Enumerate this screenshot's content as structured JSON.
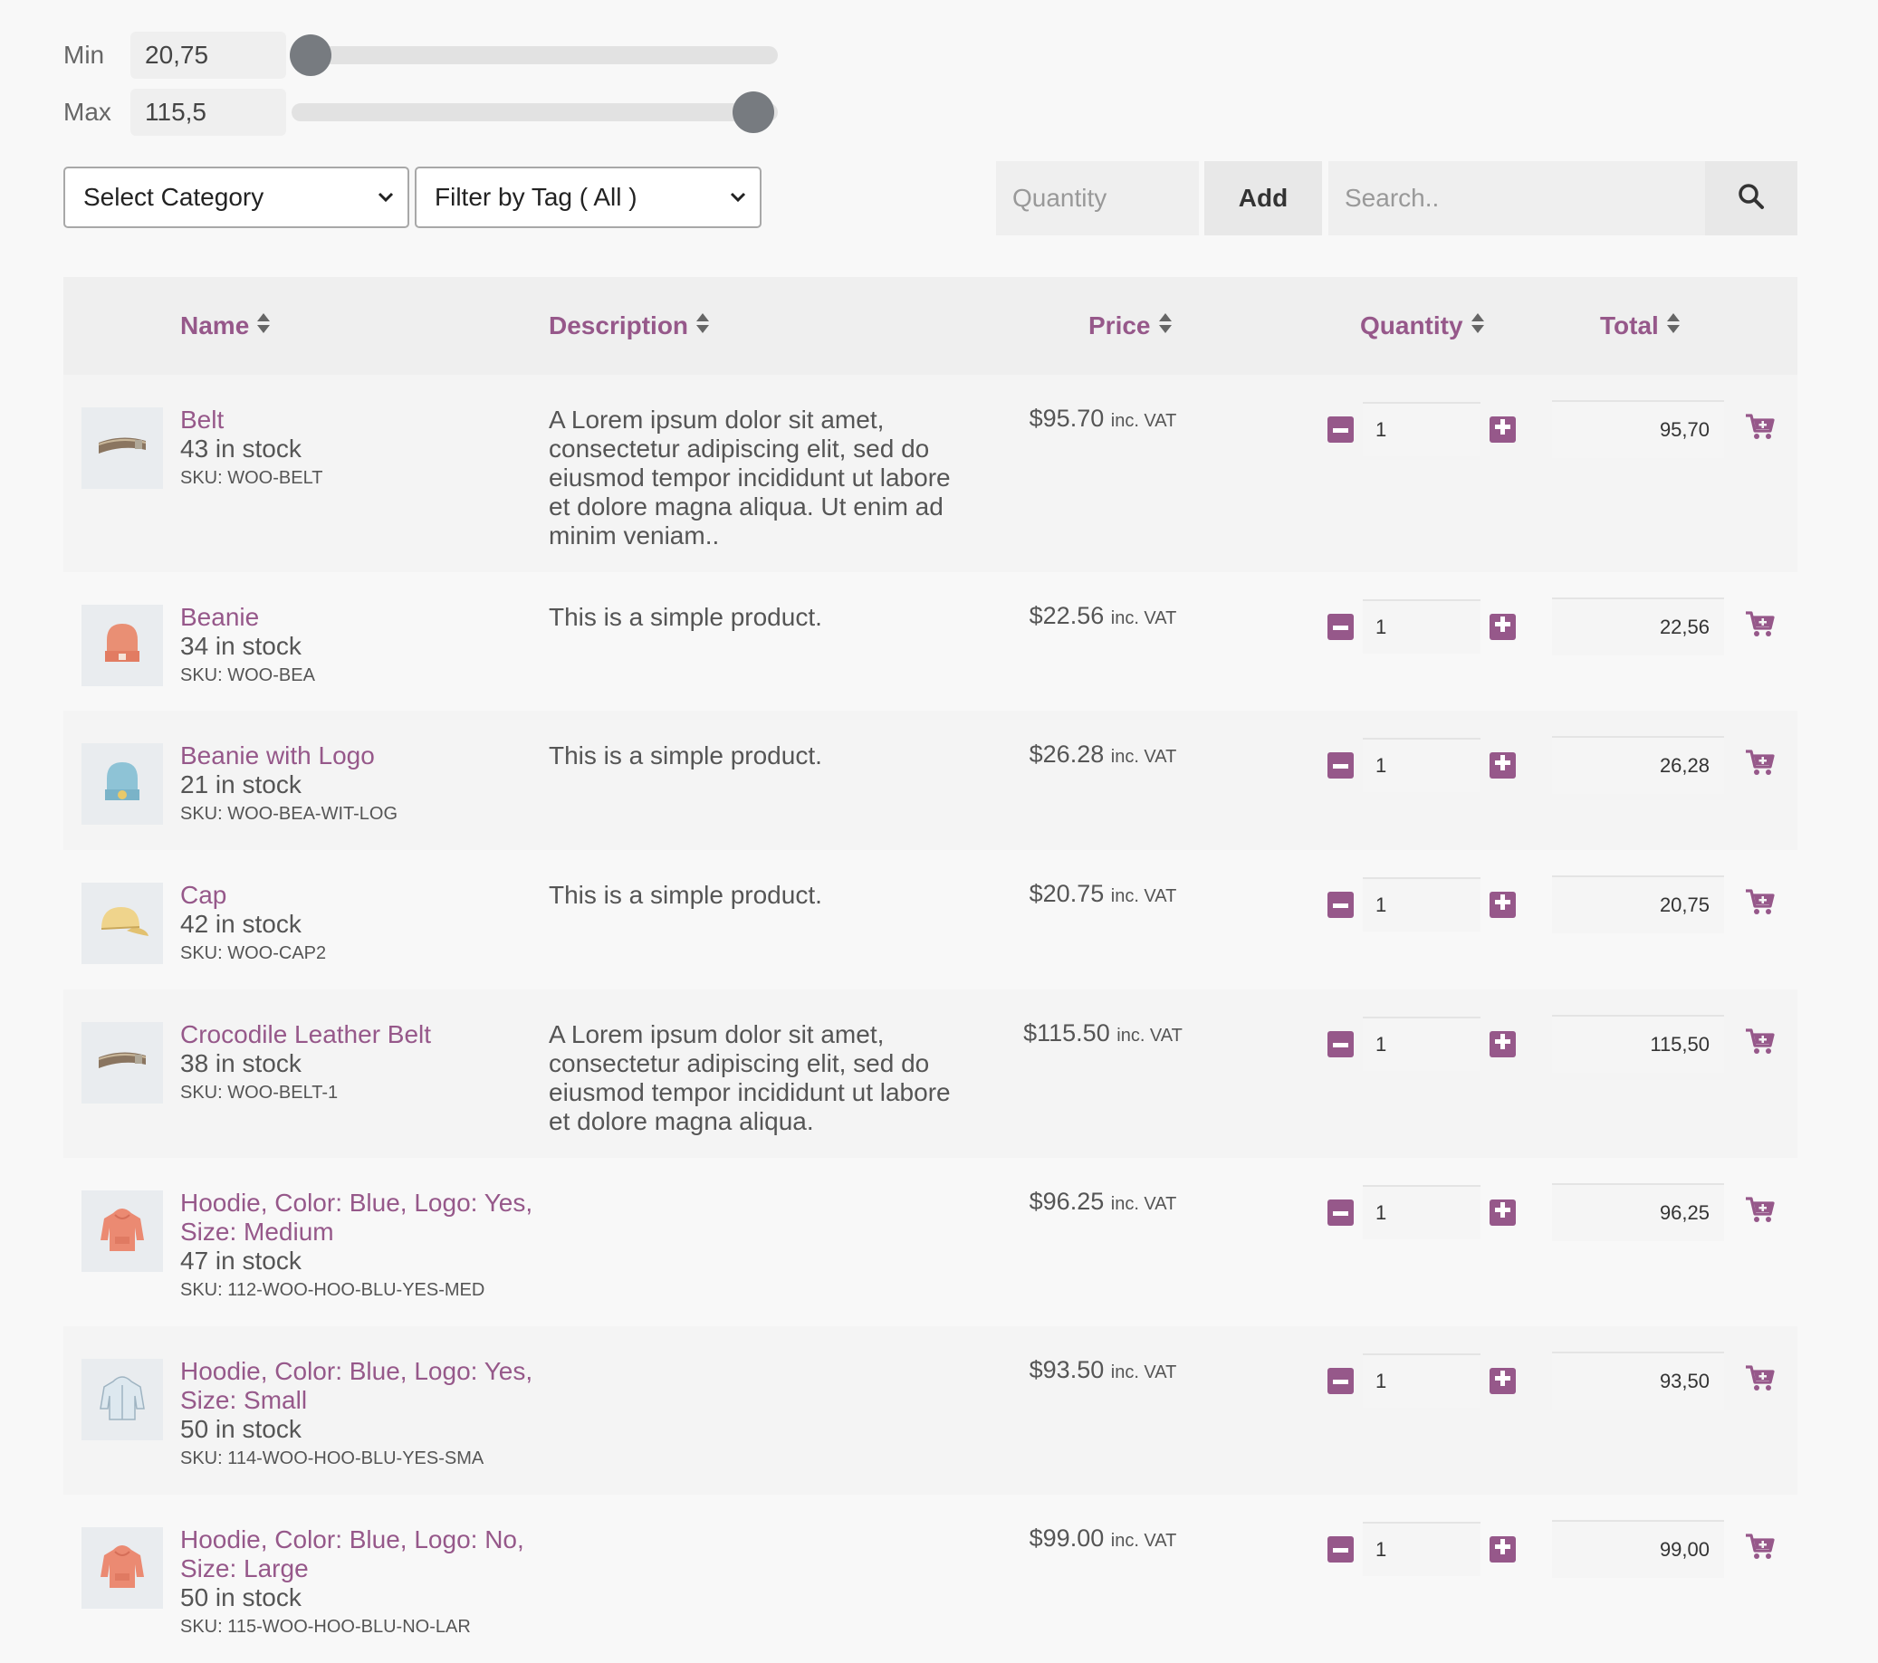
{
  "price_filter": {
    "min_label": "Min",
    "min_value": "20,75",
    "max_label": "Max",
    "max_value": "115,5",
    "min_fraction": 0.04,
    "max_fraction": 0.95
  },
  "filters": {
    "category_select": "Select Category",
    "tag_select": "Filter by Tag ( All )",
    "quantity_placeholder": "Quantity",
    "add_label": "Add",
    "search_placeholder": "Search.."
  },
  "colors": {
    "accent": "#96588a",
    "thumb_bg": "#e9ecef"
  },
  "table": {
    "headers": {
      "name": "Name",
      "description": "Description",
      "price": "Price",
      "quantity": "Quantity",
      "total": "Total"
    },
    "vat_label": "inc. VAT",
    "rows": [
      {
        "name": "Belt",
        "stock": "43 in stock",
        "sku": "SKU: WOO-BELT",
        "description": "A Lorem ipsum dolor sit amet, consectetur adipiscing elit, sed do eiusmod tempor incididunt ut labore et dolore magna aliqua. Ut enim ad minim veniam..",
        "price": "$95.70",
        "qty": "1",
        "total": "95,70",
        "thumb": "belt-icon"
      },
      {
        "name": "Beanie",
        "stock": "34 in stock",
        "sku": "SKU: WOO-BEA",
        "description": "This is a simple product.",
        "price": "$22.56",
        "qty": "1",
        "total": "22,56",
        "thumb": "beanie-icon"
      },
      {
        "name": "Beanie with Logo",
        "stock": "21 in stock",
        "sku": "SKU: WOO-BEA-WIT-LOG",
        "description": "This is a simple product.",
        "price": "$26.28",
        "qty": "1",
        "total": "26,28",
        "thumb": "beanie-logo-icon"
      },
      {
        "name": "Cap",
        "stock": "42 in stock",
        "sku": "SKU: WOO-CAP2",
        "description": "This is a simple product.",
        "price": "$20.75",
        "qty": "1",
        "total": "20,75",
        "thumb": "cap-icon"
      },
      {
        "name": "Crocodile Leather Belt",
        "stock": "38 in stock",
        "sku": "SKU: WOO-BELT-1",
        "description": "A Lorem ipsum dolor sit amet, consectetur adipiscing elit, sed do eiusmod tempor incididunt ut labore et dolore magna aliqua.",
        "price": "$115.50",
        "qty": "1",
        "total": "115,50",
        "thumb": "belt-icon"
      },
      {
        "name": "Hoodie, Color: Blue, Logo: Yes, Size: Medium",
        "stock": "47 in stock",
        "sku": "SKU: 112-WOO-HOO-BLU-YES-MED",
        "description": "",
        "price": "$96.25",
        "qty": "1",
        "total": "96,25",
        "thumb": "hoodie-icon"
      },
      {
        "name": "Hoodie, Color: Blue, Logo: Yes, Size: Small",
        "stock": "50 in stock",
        "sku": "SKU: 114-WOO-HOO-BLU-YES-SMA",
        "description": "",
        "price": "$93.50",
        "qty": "1",
        "total": "93,50",
        "thumb": "hoodie-zip-icon"
      },
      {
        "name": "Hoodie, Color: Blue, Logo: No, Size: Large",
        "stock": "50 in stock",
        "sku": "SKU: 115-WOO-HOO-BLU-NO-LAR",
        "description": "",
        "price": "$99.00",
        "qty": "1",
        "total": "99,00",
        "thumb": "hoodie-icon"
      }
    ]
  }
}
